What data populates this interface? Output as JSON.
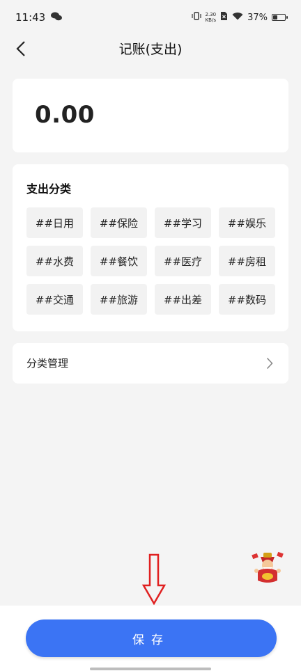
{
  "status_bar": {
    "time": "11:43",
    "net_speed_value": "2.30",
    "net_speed_unit": "KB/s",
    "battery": "37%",
    "battery_level": 0.37
  },
  "header": {
    "title": "记账(支出)"
  },
  "amount": {
    "value": "0.00"
  },
  "categories": {
    "title": "支出分类",
    "items": [
      "##日用",
      "##保险",
      "##学习",
      "##娱乐",
      "##水费",
      "##餐饮",
      "##医疗",
      "##房租",
      "##交通",
      "##旅游",
      "##出差",
      "##数码"
    ]
  },
  "manage": {
    "label": "分类管理"
  },
  "save": {
    "label": "保存"
  },
  "colors": {
    "primary": "#3b74f4",
    "annotation_arrow": "#e02020",
    "page_bg": "#f4f4f4"
  }
}
